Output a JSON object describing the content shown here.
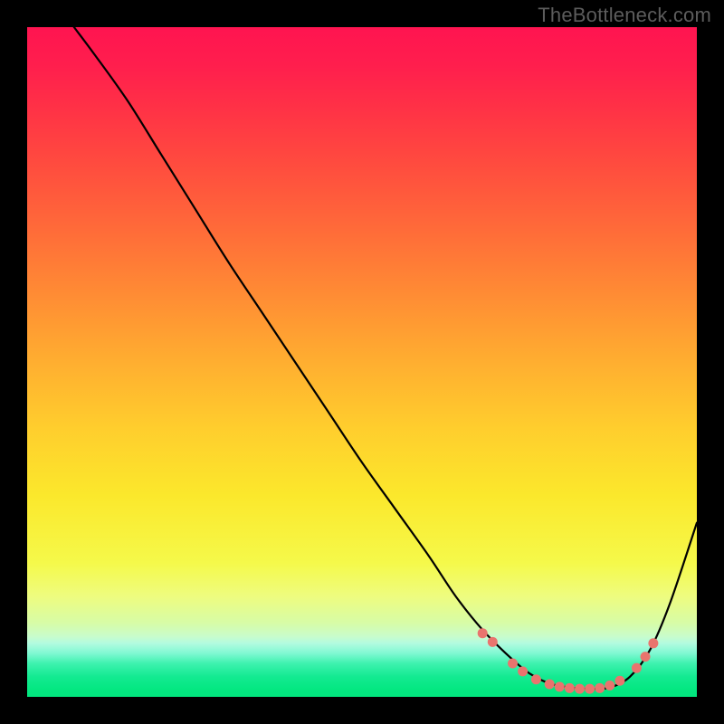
{
  "watermark": "TheBottleneck.com",
  "chart_data": {
    "type": "line",
    "title": "",
    "xlabel": "",
    "ylabel": "",
    "xlim": [
      0,
      100
    ],
    "ylim": [
      0,
      100
    ],
    "grid": false,
    "series": [
      {
        "name": "bottleneck-curve",
        "x": [
          7,
          10,
          15,
          20,
          25,
          30,
          35,
          40,
          45,
          50,
          55,
          60,
          64,
          68,
          72,
          75,
          78,
          81,
          84,
          87,
          90,
          93,
          96,
          100
        ],
        "values": [
          100,
          96,
          89,
          81,
          73,
          65,
          57.5,
          50,
          42.5,
          35,
          28,
          21,
          15,
          10,
          6,
          3.5,
          2,
          1.4,
          1.2,
          1.4,
          3,
          7,
          14,
          26
        ]
      }
    ],
    "markers": {
      "name": "flat-region-markers",
      "color": "#e9746e",
      "points": [
        [
          68,
          9.5
        ],
        [
          69.5,
          8.2
        ],
        [
          72.5,
          5.0
        ],
        [
          74,
          3.8
        ],
        [
          76,
          2.6
        ],
        [
          78,
          1.9
        ],
        [
          79.5,
          1.5
        ],
        [
          81,
          1.3
        ],
        [
          82.5,
          1.2
        ],
        [
          84,
          1.2
        ],
        [
          85.5,
          1.3
        ],
        [
          87,
          1.7
        ],
        [
          88.5,
          2.4
        ],
        [
          91,
          4.3
        ],
        [
          92.3,
          6.0
        ],
        [
          93.5,
          8.0
        ]
      ]
    }
  }
}
